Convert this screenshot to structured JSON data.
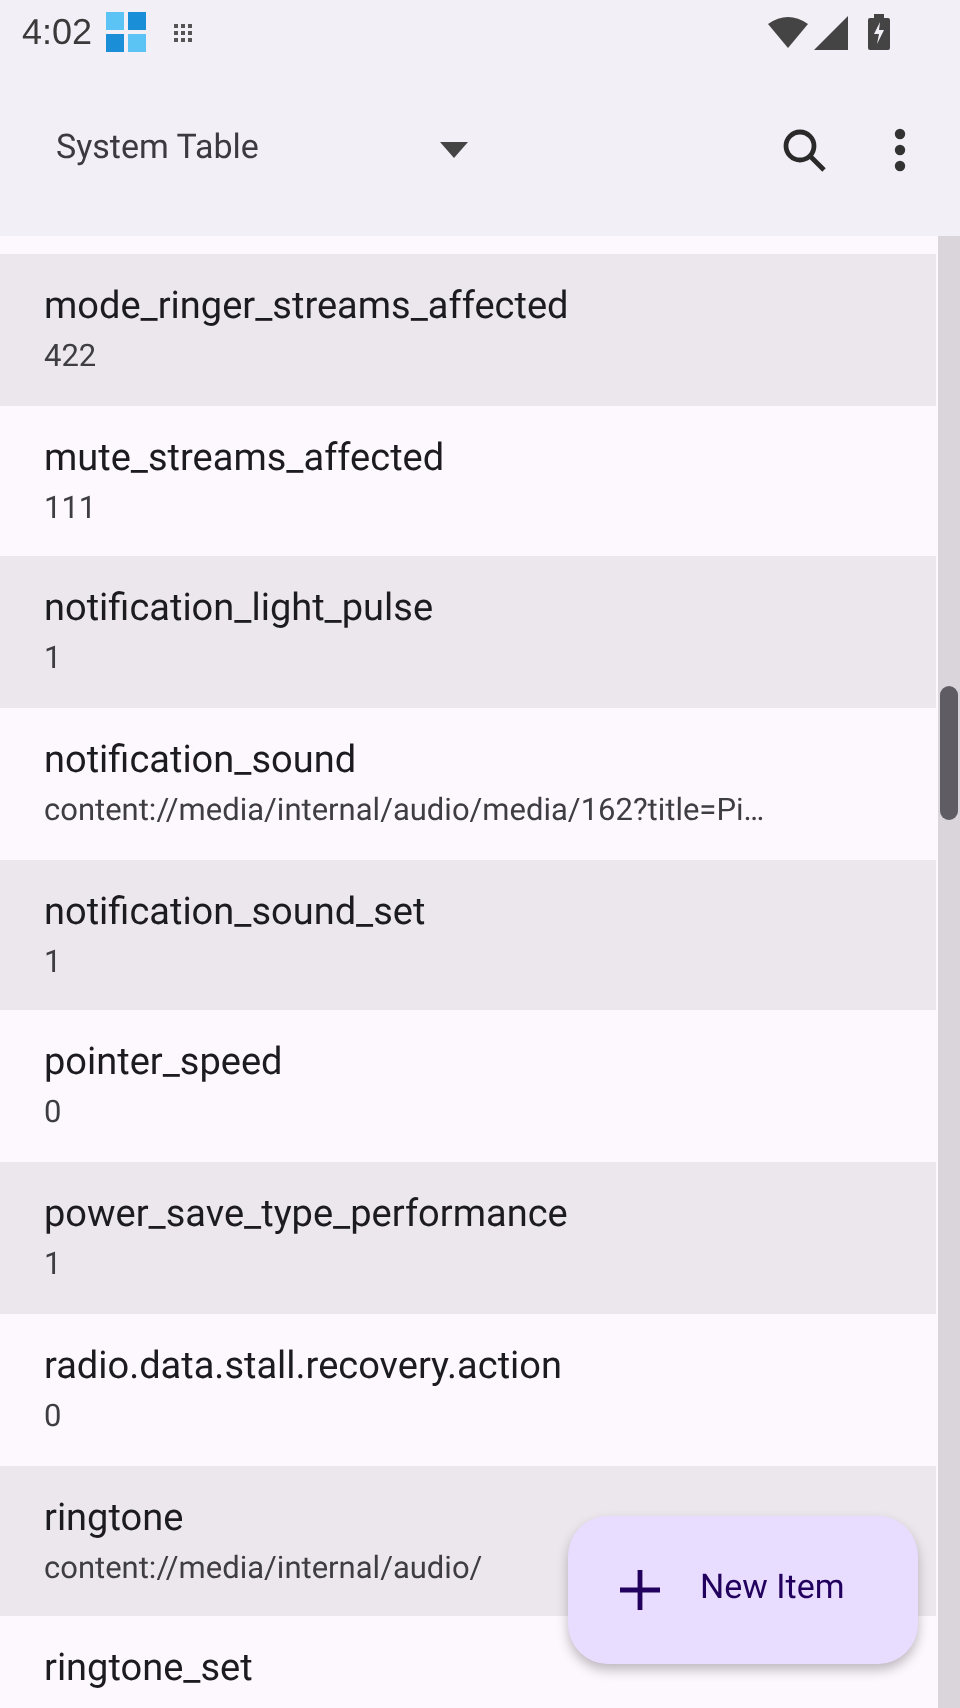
{
  "status_bar": {
    "time": "4:02"
  },
  "toolbar": {
    "title": "System Table"
  },
  "rows": [
    {
      "name": "mode_ringer_streams_affected",
      "value": "422"
    },
    {
      "name": "mute_streams_affected",
      "value": "111"
    },
    {
      "name": "notification_light_pulse",
      "value": "1"
    },
    {
      "name": "notification_sound",
      "value": "content://media/internal/audio/media/162?title=Pi…"
    },
    {
      "name": "notification_sound_set",
      "value": "1"
    },
    {
      "name": "pointer_speed",
      "value": "0"
    },
    {
      "name": "power_save_type_performance",
      "value": "1"
    },
    {
      "name": "radio.data.stall.recovery.action",
      "value": "0"
    },
    {
      "name": "ringtone",
      "value": "content://media/internal/audio/"
    },
    {
      "name": "ringtone_set"
    }
  ],
  "fab": {
    "label": "New Item"
  }
}
